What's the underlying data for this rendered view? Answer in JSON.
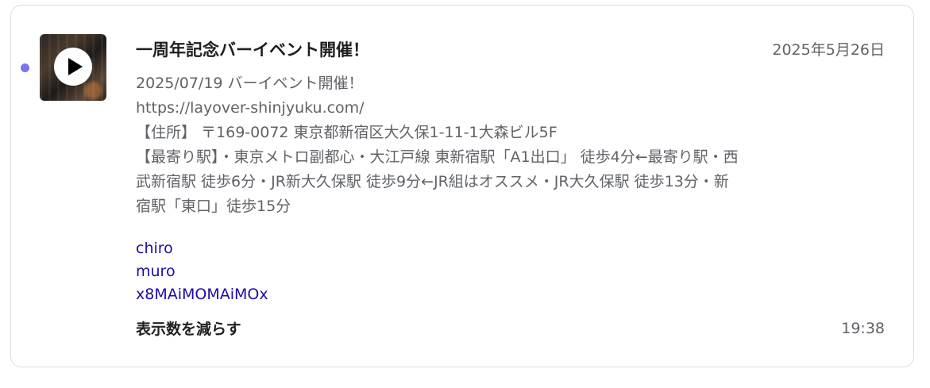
{
  "notification": {
    "title": "一周年記念バーイベント開催！",
    "date": "2025年5月26日",
    "body_lines": [
      "2025/07/19 バーイベント開催！",
      "https://layover-shinjyuku.com/",
      "【住所】 〒169-0072 東京都新宿区大久保1-11-1大森ビル5F",
      "【最寄り駅】・東京メトロ副都心・大江戸線 東新宿駅「A1出口」 徒歩4分←最寄り駅・西武新宿駅 徒歩6分・JR新大久保駅 徒歩9分←JR組はオススメ・JR大久保駅 徒歩13分・新宿駅「東口」徒歩15分"
    ],
    "links": [
      "chiro",
      "muro",
      "x8MAiMOMAiMOx"
    ],
    "show_less_label": "表示数を減らす",
    "time": "19:38",
    "unread_color": "#7b74ee",
    "thumbnail_icon": "play-icon"
  }
}
